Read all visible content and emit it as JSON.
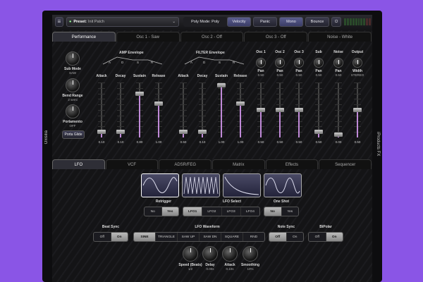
{
  "device": {
    "left_label": "Oxisilia",
    "right_label": "iProducts FX"
  },
  "topbar": {
    "preset_label": "Preset:",
    "preset_value": "Init Patch",
    "poly_mode": "Poly Mode: Poly",
    "velocity": "Velocity",
    "panic": "Panic",
    "mono": "Mono",
    "bounce": "Bounce"
  },
  "top_tabs": [
    "Performance",
    "Osc 1 - Saw",
    "Osc 2 - Off",
    "Osc 3 - Off",
    "Noise - White"
  ],
  "performance": {
    "sub_mode": {
      "label": "Sub Mode",
      "value": "SAW"
    },
    "bend_range": {
      "label": "Bend Range",
      "value": "2 semi"
    },
    "portamento": {
      "label": "Portamento",
      "value": "OFF"
    },
    "porta_glide": "Porta Glide",
    "amp_title": "AMP Envelope",
    "filter_title": "FILTER Envelope",
    "env_letters": [
      "A",
      "D",
      "S",
      "R"
    ],
    "osc_knobs": [
      {
        "name": "Osc 1",
        "pan_label": "Pan",
        "pan_value": "0.50"
      },
      {
        "name": "Osc 2",
        "pan_label": "Pan",
        "pan_value": "0.50"
      },
      {
        "name": "Osc 3",
        "pan_label": "Pan",
        "pan_value": "0.50"
      },
      {
        "name": "Sub",
        "pan_label": "Pan",
        "pan_value": "0.50"
      },
      {
        "name": "Noise",
        "pan_label": "Pan",
        "pan_value": "0.50"
      },
      {
        "name": "Output",
        "pan_label": "Width",
        "pan_value": "STEREO"
      }
    ],
    "sliders": [
      {
        "label": "Attack",
        "value": "0.10",
        "level": 0.1
      },
      {
        "label": "Decay",
        "value": "0.10",
        "level": 0.1
      },
      {
        "label": "Sustain",
        "value": "0.80",
        "level": 0.8
      },
      {
        "label": "Release",
        "value": "1.00",
        "level": 0.62
      },
      {
        "label": "Attack",
        "value": "0.50",
        "level": 0.1
      },
      {
        "label": "Decay",
        "value": "0.10",
        "level": 0.1
      },
      {
        "label": "Sustain",
        "value": "1.00",
        "level": 0.95
      },
      {
        "label": "Release",
        "value": "1.00",
        "level": 0.62
      },
      {
        "label": "",
        "value": "0.50",
        "level": 0.5
      },
      {
        "label": "",
        "value": "0.50",
        "level": 0.5
      },
      {
        "label": "",
        "value": "0.50",
        "level": 0.5
      },
      {
        "label": "",
        "value": "0.50",
        "level": 0.1
      },
      {
        "label": "",
        "value": "0.00",
        "level": 0.05
      },
      {
        "label": "",
        "value": "0.50",
        "level": 0.5
      }
    ]
  },
  "bottom_tabs": [
    "LFO",
    "VCF",
    "ADSR/FEG",
    "Matrix",
    "Effects",
    "Sequencer"
  ],
  "lfo": {
    "retrigger": {
      "label": "Retrigger",
      "options": [
        "No",
        "Yes"
      ],
      "selected": 1
    },
    "lfo_select": {
      "label": "LFO Select",
      "options": [
        "LFO1",
        "LFO2",
        "LFO3",
        "LFO4"
      ],
      "selected": 0
    },
    "one_shot": {
      "label": "One Shot",
      "options": [
        "No",
        "Yes"
      ],
      "selected": 0
    },
    "beat_sync": {
      "label": "Beat Sync",
      "options": [
        "Off",
        "On"
      ],
      "selected": 1
    },
    "waveform": {
      "label": "LFO Waveform",
      "options": [
        "SINE",
        "TRIANGLE",
        "SAW UP",
        "SAW DN",
        "SQUARE",
        "RND"
      ],
      "selected": 0
    },
    "note_sync": {
      "label": "Note Sync",
      "options": [
        "Off",
        "On"
      ],
      "selected": 0
    },
    "bipolar": {
      "label": "BiPolar",
      "options": [
        "Off",
        "On"
      ],
      "selected": 1
    },
    "knobs": [
      {
        "label": "Speed (Beats)",
        "value": "1/2"
      },
      {
        "label": "Delay",
        "value": "0.00s"
      },
      {
        "label": "Attack",
        "value": "0.10s"
      },
      {
        "label": "Smoothing",
        "value": "10%"
      }
    ]
  }
}
